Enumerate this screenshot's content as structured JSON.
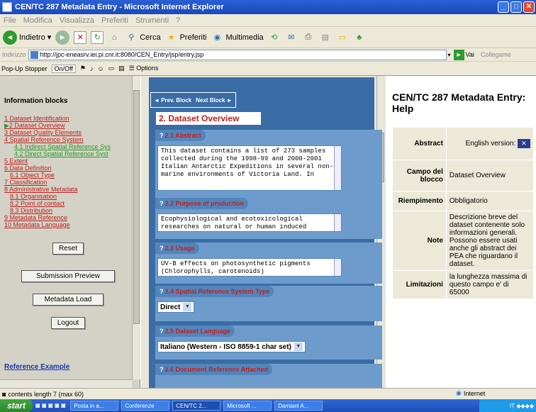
{
  "window": {
    "title": "CEN/TC 287 Metadata Entry - Microsoft Internet Explorer"
  },
  "menu": [
    "File",
    "Modifica",
    "Visualizza",
    "Preferiti",
    "Strumenti",
    "?"
  ],
  "toolbar": {
    "back": "Indietro",
    "search": "Cerca",
    "favorites": "Preferiti",
    "media": "Multimedia"
  },
  "address": {
    "label": "Indirizzo",
    "url": "http://jpc-eneasrv.iei.pi.cnr.it:8080/CEN_Entry/jsp/entry.jsp",
    "go": "Vai",
    "links": "Collegame"
  },
  "popup": {
    "stopper": "Pop-Up Stopper",
    "onoff": "On/Off",
    "options": "Options"
  },
  "left": {
    "title": "Information blocks",
    "items": [
      {
        "label": "1 Dataset Identification",
        "level": 0
      },
      {
        "label": "2 Dataset Overview",
        "level": 0,
        "active": true
      },
      {
        "label": "3 Dataset Quality Elements",
        "level": 0
      },
      {
        "label": "4 Spatial Reference System",
        "level": 0
      },
      {
        "label": "4.1 Indirect Spatial Reference Sys",
        "level": 2
      },
      {
        "label": "4.2 Direct Spatial Reference Syst",
        "level": 2
      },
      {
        "label": "5 Extent",
        "level": 0
      },
      {
        "label": "6 Data Definition",
        "level": 0
      },
      {
        "label": "6.1 Object Type",
        "level": 1
      },
      {
        "label": "7 Classification",
        "level": 0
      },
      {
        "label": "8 Administrative Metadata",
        "level": 0
      },
      {
        "label": "8.1 Organisation",
        "level": 1
      },
      {
        "label": "8.2 Point of contact",
        "level": 1
      },
      {
        "label": "8.3 Distribution",
        "level": 1
      },
      {
        "label": "9 Metadata Reference",
        "level": 0
      },
      {
        "label": "10 Metadata Language",
        "level": 0
      }
    ],
    "buttons": {
      "reset": "Reset",
      "submission": "Submission Preview",
      "load": "Metadata Load",
      "logout": "Logout"
    },
    "reference": "Reference Example"
  },
  "mid": {
    "prev": "Prev. Block",
    "next": "Next Block",
    "section_title": "2. Dataset Overview",
    "sections": [
      {
        "title": "2.1 Abstract",
        "text": "This dataset contains a list of 273 samples collected during the 1998-99 and 2000-2001 Italian Antarctic Expeditions in several non-marine environments of Victoria Land. In"
      },
      {
        "title": "2.2 Purpose of production",
        "text": "Ecophysiological and ecotoxicological researches on natural or human induced"
      },
      {
        "title": "2.3 Usage",
        "text": "UV-B effects on photosynthetic pigments (Chlorophylls, carotenoids)"
      },
      {
        "title": "2.4 Spatial Reference System Type",
        "select": "Direct"
      },
      {
        "title": "2.5 Dataset Language",
        "select": "Italiano (Western - ISO 8859-1 char set)"
      },
      {
        "title": "2.6 Document Reference Attached"
      }
    ]
  },
  "help": {
    "title": "CEN/TC 287 Metadata Entry: Help",
    "rows": [
      {
        "k": "Abstract",
        "v": "English version:"
      },
      {
        "k": "Campo del blocco",
        "v": "Dataset Overview"
      },
      {
        "k": "Riempimento",
        "v": "Obbligatorio"
      },
      {
        "k": "Note",
        "v": "Descrizione breve del dataset contenente solo informazioni generali. Possono essere usati anche gli abstract dei PEA che riguardano il dataset."
      },
      {
        "k": "Limitazioni",
        "v": "la lunghezza massima di questo campo e' di 65000"
      }
    ]
  },
  "status": {
    "text": "contents length 7 (max 60)",
    "zone": "Internet"
  },
  "taskbar": {
    "start": "start",
    "tasks": [
      "Posta in a...",
      "Conferenze",
      "CEN/TC 2...",
      "Microsoft ...",
      "Damiani A..."
    ],
    "tray": "IT"
  },
  "colors": {
    "accent": "#3a6da6",
    "link": "#c02020",
    "panel": "#6d9ccc"
  }
}
